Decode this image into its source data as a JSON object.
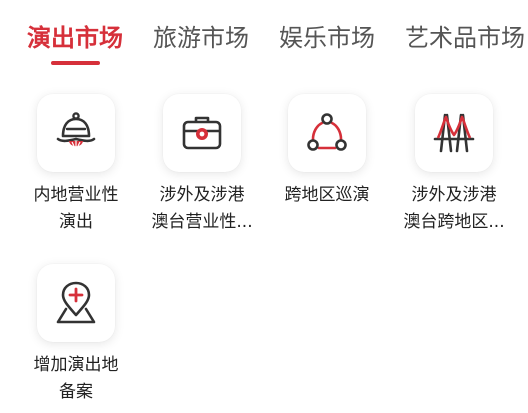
{
  "colors": {
    "accent": "#d6303a",
    "text": "#222222",
    "tab_inactive": "#555555",
    "icon_dark": "#333333"
  },
  "tabs": [
    {
      "label": "演出市场",
      "active": true
    },
    {
      "label": "旅游市场",
      "active": false
    },
    {
      "label": "娱乐市场",
      "active": false
    },
    {
      "label": "艺术品市场",
      "active": false
    }
  ],
  "services": [
    {
      "icon": "bell-icon",
      "label_line1": "内地营业性",
      "label_line2": "演出"
    },
    {
      "icon": "briefcase-icon",
      "label_line1": "涉外及涉港",
      "label_line2": "澳台营业性..."
    },
    {
      "icon": "tour-route-icon",
      "label_line1": "跨地区巡演",
      "label_line2": ""
    },
    {
      "icon": "bridge-icon",
      "label_line1": "涉外及涉港",
      "label_line2": "澳台跨地区..."
    },
    {
      "icon": "location-add-icon",
      "label_line1": "增加演出地",
      "label_line2": "备案"
    }
  ]
}
